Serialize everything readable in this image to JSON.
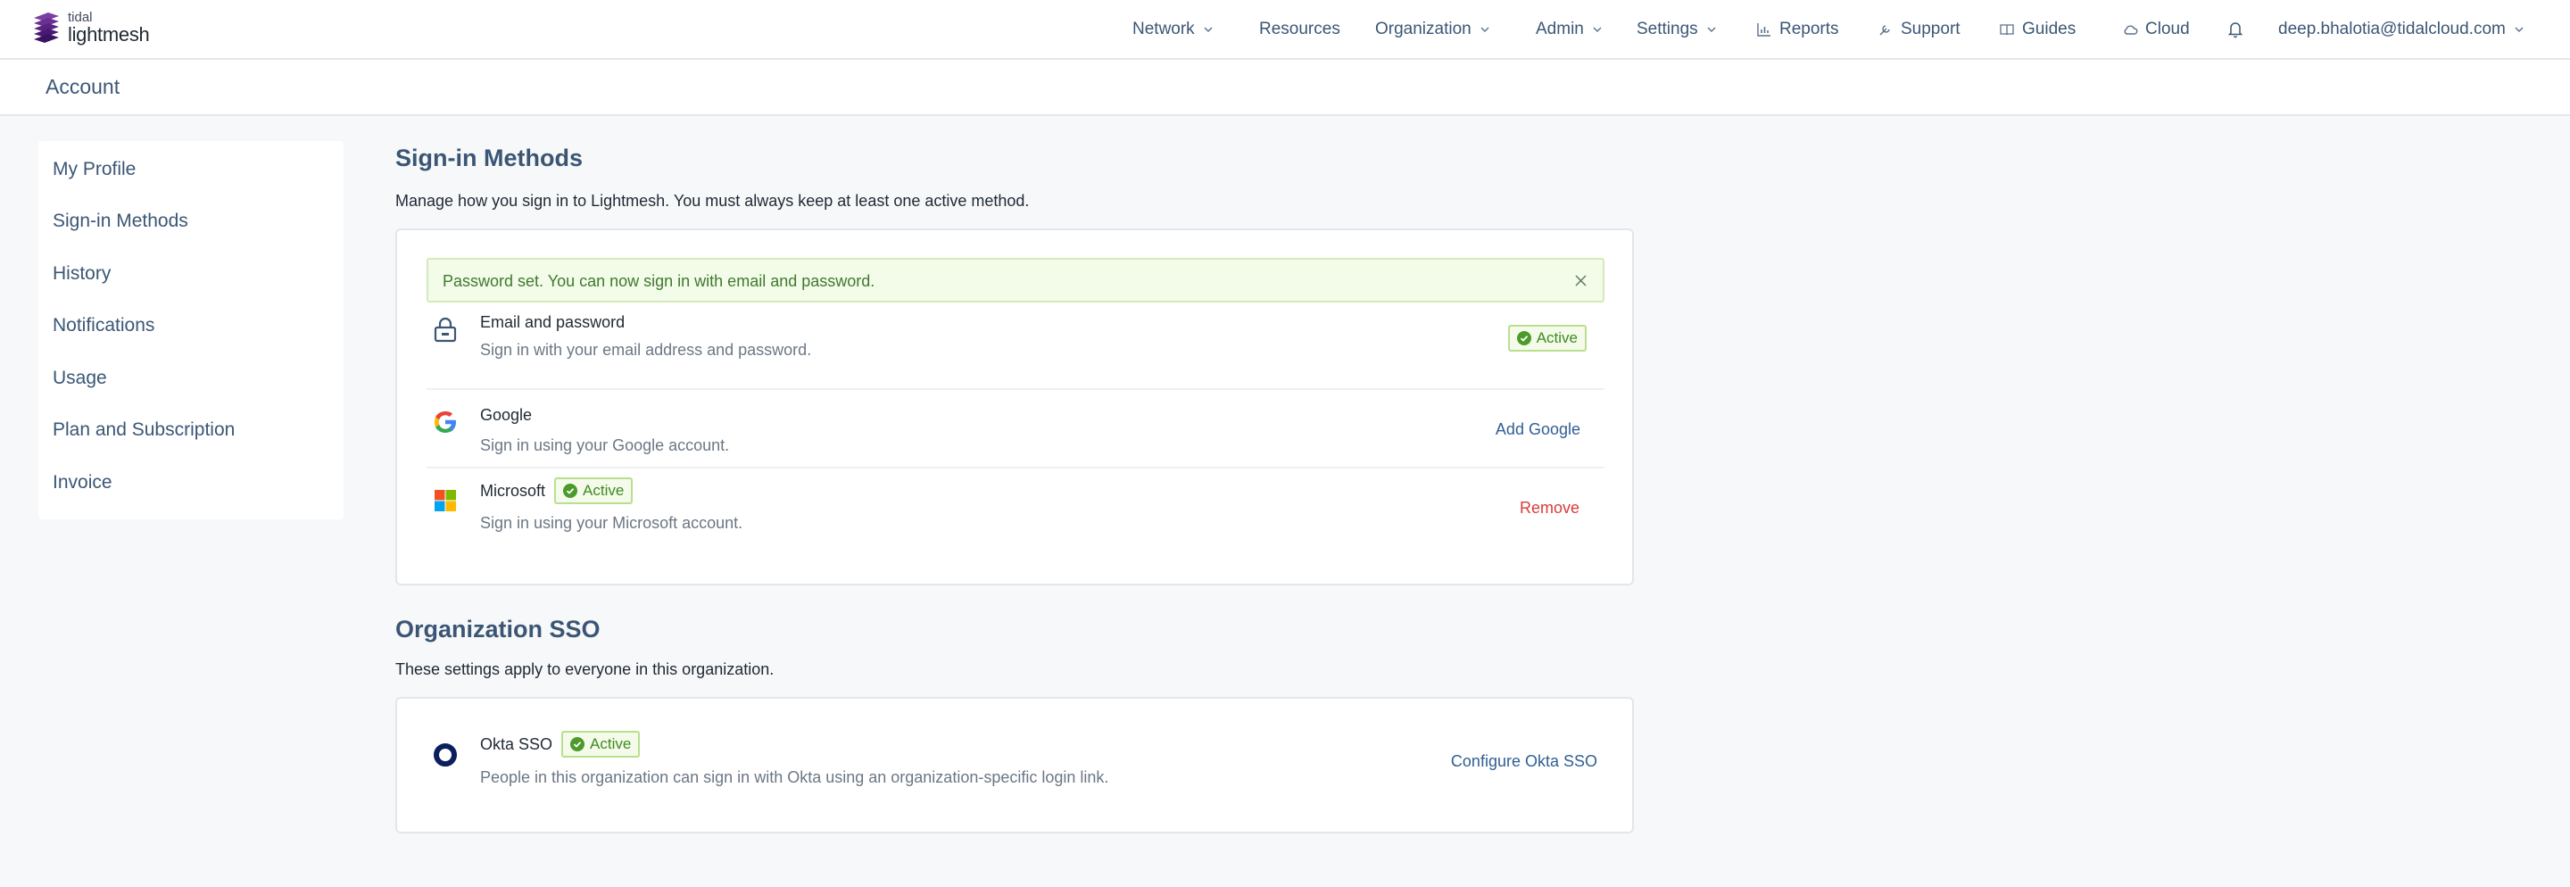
{
  "brand": {
    "small": "tidal",
    "name": "lightmesh"
  },
  "nav": {
    "network": "Network",
    "resources": "Resources",
    "organization": "Organization",
    "admin": "Admin",
    "settings": "Settings",
    "reports": "Reports",
    "support": "Support",
    "guides": "Guides",
    "cloud": "Cloud",
    "user": "deep.bhalotia@tidalcloud.com"
  },
  "account": {
    "title": "Account"
  },
  "sidebar": {
    "items": [
      {
        "label": "My Profile"
      },
      {
        "label": "Sign-in Methods"
      },
      {
        "label": "History"
      },
      {
        "label": "Notifications"
      },
      {
        "label": "Usage"
      },
      {
        "label": "Plan and Subscription"
      },
      {
        "label": "Invoice"
      }
    ]
  },
  "signin": {
    "title": "Sign-in Methods",
    "description": "Manage how you sign in to Lightmesh. You must always keep at least one active method.",
    "alert": "Password set. You can now sign in with email and password.",
    "methods": [
      {
        "title": "Email and password",
        "description": "Sign in with your email address and password.",
        "status": "Active",
        "icon": "lock-icon"
      },
      {
        "title": "Google",
        "description": "Sign in using your Google account.",
        "action": "Add Google",
        "icon": "google-icon"
      },
      {
        "title": "Microsoft",
        "description": "Sign in using your Microsoft account.",
        "status": "Active",
        "action": "Remove",
        "icon": "microsoft-icon"
      }
    ]
  },
  "sso": {
    "title": "Organization SSO",
    "description": "These settings apply to everyone in this organization.",
    "provider": {
      "title": "Okta SSO",
      "status": "Active",
      "description": "People in this organization can sign in with Okta using an organization-specific login link.",
      "action": "Configure Okta SSO",
      "icon": "okta-icon"
    }
  },
  "colors": {
    "accent": "#3b5675",
    "link": "#2f5f95",
    "danger": "#d93b3b",
    "success": "#3f8a1f",
    "success_bg": "#f4fbea",
    "alert_bg": "#f3fbe9"
  }
}
